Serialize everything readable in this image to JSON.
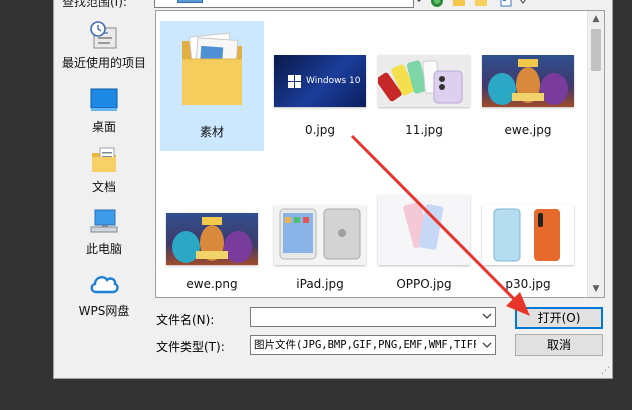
{
  "dialog": {
    "lookin_label": "查找范围(I):",
    "places": [
      {
        "label": "最近使用的项目",
        "icon": "recent-items-icon"
      },
      {
        "label": "桌面",
        "icon": "desktop-icon"
      },
      {
        "label": "文档",
        "icon": "documents-icon"
      },
      {
        "label": "此电脑",
        "icon": "computer-icon"
      },
      {
        "label": "WPS网盘",
        "icon": "cloud-icon"
      }
    ],
    "files": [
      {
        "name": "素材",
        "kind": "folder"
      },
      {
        "name": "0.jpg",
        "kind": "image",
        "caption": "Windows 10"
      },
      {
        "name": "11.jpg",
        "kind": "image"
      },
      {
        "name": "ewe.jpg",
        "kind": "image"
      },
      {
        "name": "ewe.png",
        "kind": "image"
      },
      {
        "name": "iPad.jpg",
        "kind": "image"
      },
      {
        "name": "OPPO.jpg",
        "kind": "image"
      },
      {
        "name": "p30.jpg",
        "kind": "image"
      }
    ],
    "filename_label": "文件名(N):",
    "filename_value": "",
    "filetype_label": "文件类型(T):",
    "filetype_value": "图片文件(JPG,BMP,GIF,PNG,EMF,WMF,TIFF",
    "open_button": "打开(O)",
    "cancel_button": "取消"
  },
  "colors": {
    "accent": "#0078d7",
    "selection": "#cce8ff",
    "annotation_arrow": "#e8352b",
    "background": "#333333"
  }
}
